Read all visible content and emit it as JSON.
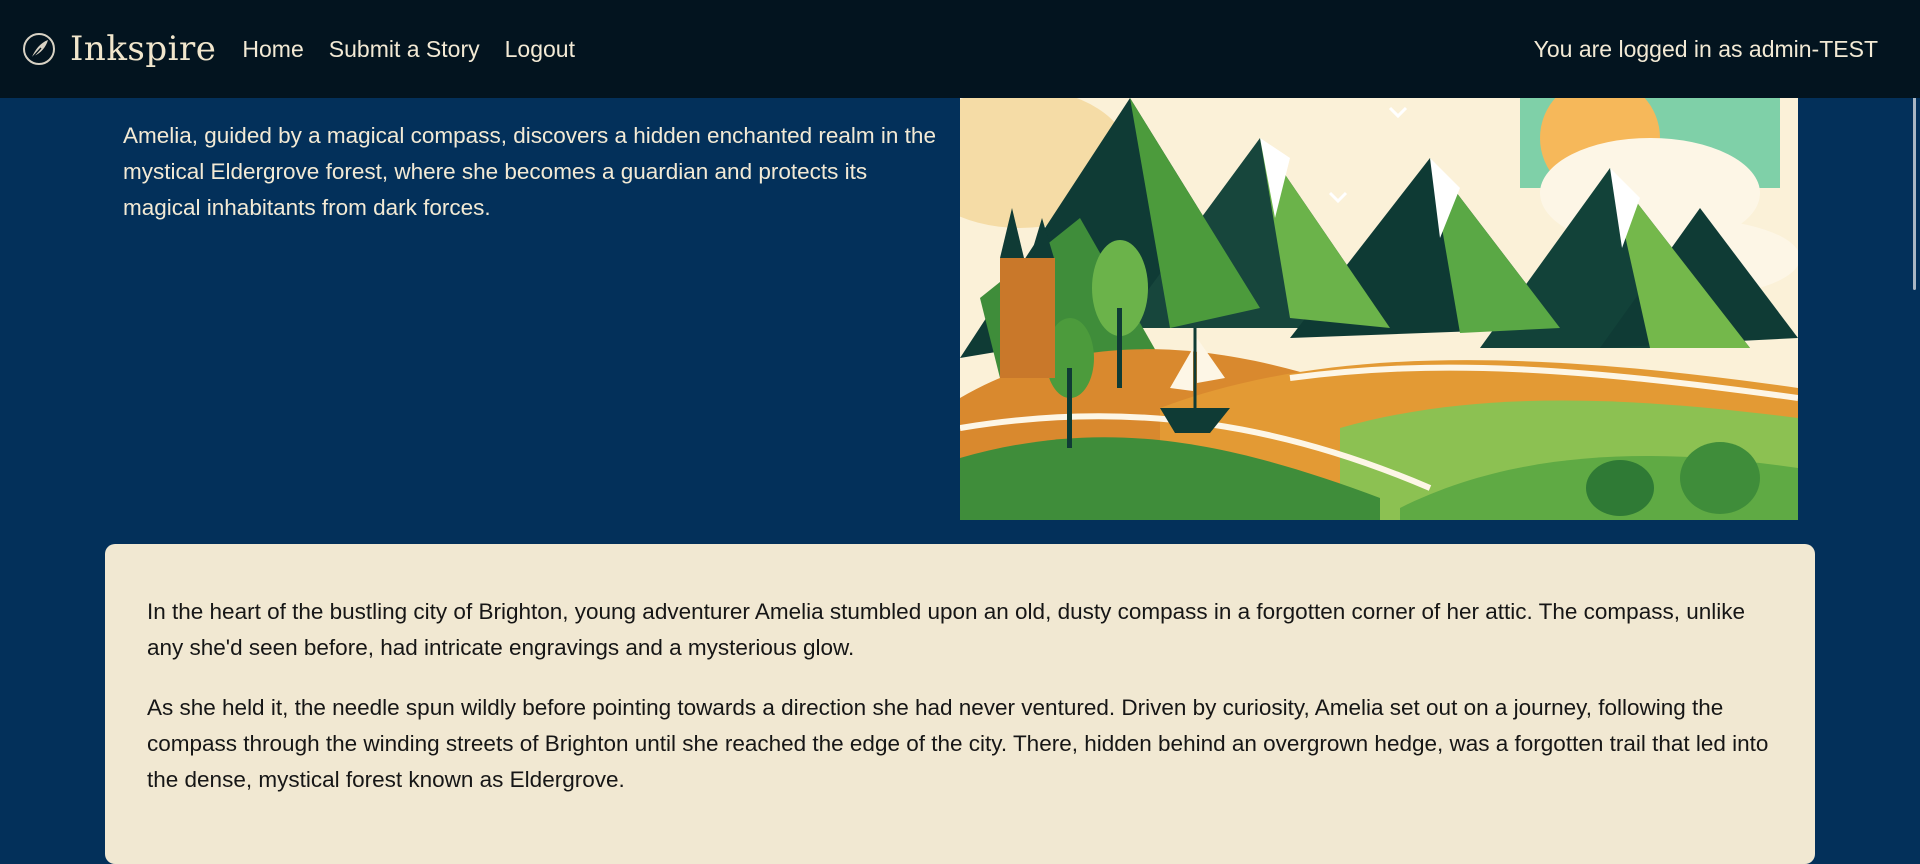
{
  "brand": {
    "name": "Inkspire",
    "icon": "quill-feather-icon"
  },
  "nav": {
    "items": [
      {
        "label": "Home"
      },
      {
        "label": "Submit a Story"
      },
      {
        "label": "Logout"
      }
    ]
  },
  "user": {
    "status": "You are logged in as admin-TEST"
  },
  "story": {
    "summary": "Amelia, guided by a magical compass, discovers a hidden enchanted realm in the mystical Eldergrove forest, where she becomes a guardian and protects its magical inhabitants from dark forces.",
    "paragraphs": [
      "In the heart of the bustling city of Brighton, young adventurer Amelia stumbled upon an old, dusty compass in a forgotten corner of her attic. The compass, unlike any she'd seen before, had intricate engravings and a mysterious glow.",
      "As she held it, the needle spun wildly before pointing towards a direction she had never ventured. Driven by curiosity, Amelia set out on a journey, following the compass through the winding streets of Brighton until she reached the edge of the city. There, hidden behind an overgrown hedge, was a forgotten trail that led into the dense, mystical forest known as Eldergrove."
    ]
  },
  "colors": {
    "navbar": "#03141f",
    "page_background": "#03305a",
    "card_background": "#f1e8d2",
    "nav_text": "#f3ead5"
  }
}
